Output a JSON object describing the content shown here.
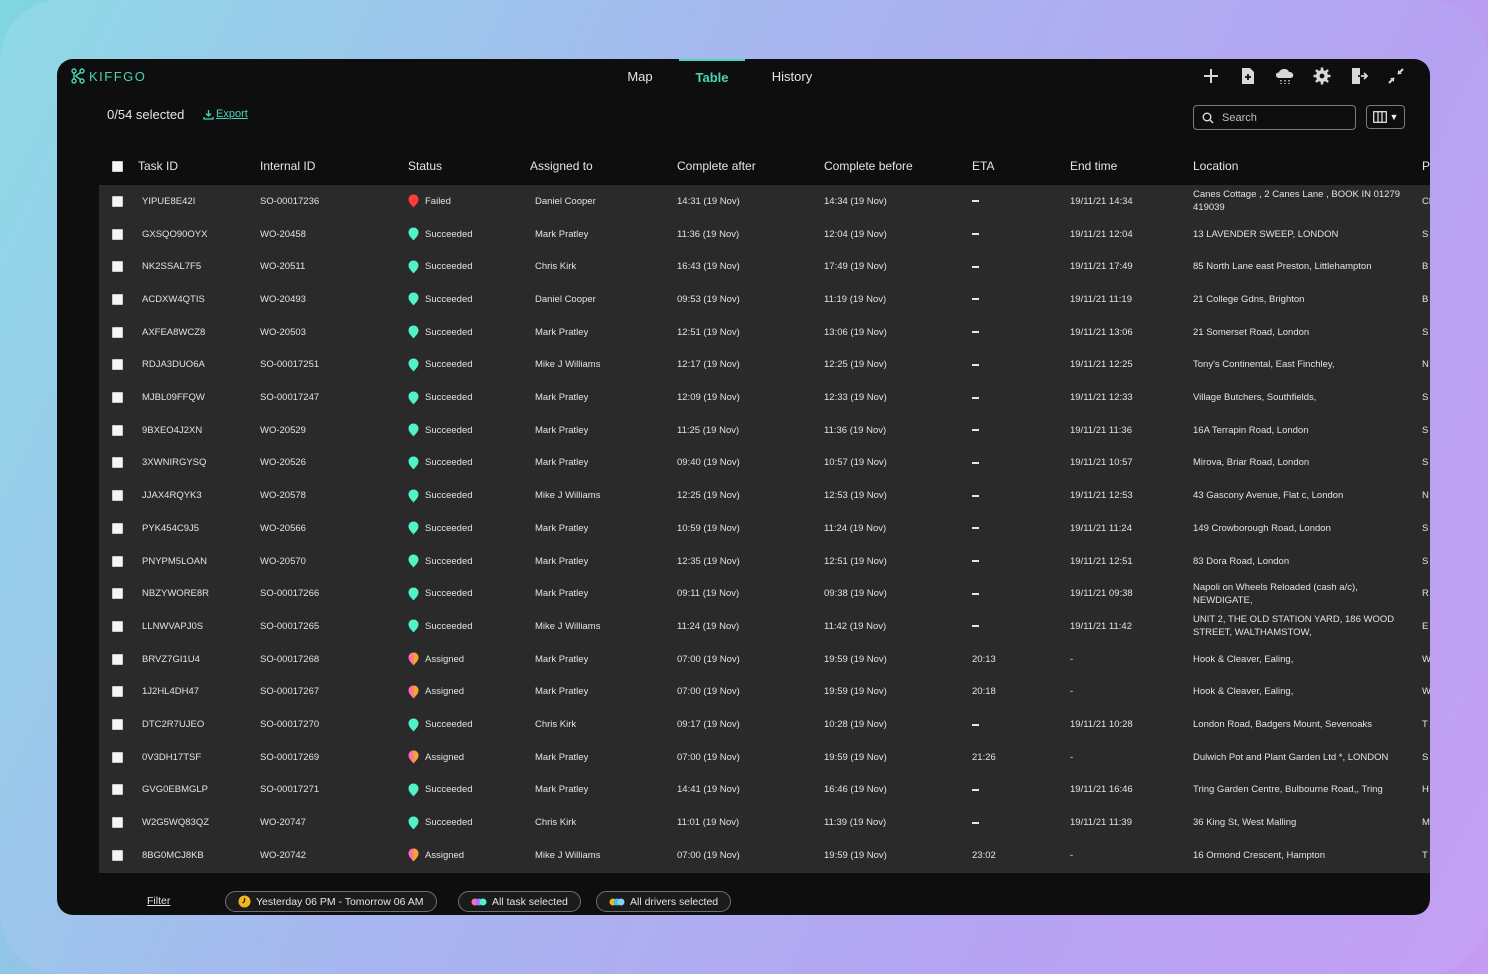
{
  "app": {
    "logo_text": "KIFFGO",
    "nav": {
      "tabs": [
        "Map",
        "Table",
        "History"
      ],
      "active": "Table"
    },
    "tools": [
      "plus-icon",
      "new-document-icon",
      "cloud-upload-icon",
      "gear-icon",
      "logout-icon",
      "collapse-icon"
    ]
  },
  "toolbar": {
    "selected": "0/54 selected",
    "export": "Export",
    "search_placeholder": "Search"
  },
  "table": {
    "columns": [
      "Task ID",
      "Internal ID",
      "Status",
      "Assigned to",
      "Complete after",
      "Complete before",
      "ETA",
      "End time",
      "Location",
      "P"
    ],
    "rows": [
      {
        "task_id": "YIPUE8E42I",
        "internal_id": "SO-00017236",
        "status": "Failed",
        "assigned": "Daniel Cooper",
        "after": "14:31 (19 Nov)",
        "before": "14:34 (19 Nov)",
        "eta": "",
        "end": "19/11/21 14:34",
        "location": "Canes Cottage , 2 Canes Lane , BOOK IN 01279 419039",
        "p": "Cl"
      },
      {
        "task_id": "GXSQO90OYX",
        "internal_id": "WO-20458",
        "status": "Succeeded",
        "assigned": "Mark Pratley",
        "after": "11:36 (19 Nov)",
        "before": "12:04 (19 Nov)",
        "eta": "",
        "end": "19/11/21 12:04",
        "location": "13 LAVENDER SWEEP, LONDON",
        "p": "S"
      },
      {
        "task_id": "NK2SSAL7F5",
        "internal_id": "WO-20511",
        "status": "Succeeded",
        "assigned": "Chris Kirk",
        "after": "16:43 (19 Nov)",
        "before": "17:49 (19 Nov)",
        "eta": "",
        "end": "19/11/21 17:49",
        "location": "85 North Lane east Preston, Littlehampton",
        "p": "B"
      },
      {
        "task_id": "ACDXW4QTIS",
        "internal_id": "WO-20493",
        "status": "Succeeded",
        "assigned": "Daniel Cooper",
        "after": "09:53 (19 Nov)",
        "before": "11:19 (19 Nov)",
        "eta": "",
        "end": "19/11/21 11:19",
        "location": "21 College Gdns, Brighton",
        "p": "B"
      },
      {
        "task_id": "AXFEA8WCZ8",
        "internal_id": "WO-20503",
        "status": "Succeeded",
        "assigned": "Mark Pratley",
        "after": "12:51 (19 Nov)",
        "before": "13:06 (19 Nov)",
        "eta": "",
        "end": "19/11/21 13:06",
        "location": "21 Somerset Road, London",
        "p": "S"
      },
      {
        "task_id": "RDJA3DUO6A",
        "internal_id": "SO-00017251",
        "status": "Succeeded",
        "assigned": "Mike J Williams",
        "after": "12:17 (19 Nov)",
        "before": "12:25 (19 Nov)",
        "eta": "",
        "end": "19/11/21 12:25",
        "location": "Tony's Continental, East Finchley,",
        "p": "N"
      },
      {
        "task_id": "MJBL09FFQW",
        "internal_id": "SO-00017247",
        "status": "Succeeded",
        "assigned": "Mark Pratley",
        "after": "12:09 (19 Nov)",
        "before": "12:33 (19 Nov)",
        "eta": "",
        "end": "19/11/21 12:33",
        "location": "Village Butchers, Southfields,",
        "p": "S"
      },
      {
        "task_id": "9BXEO4J2XN",
        "internal_id": "WO-20529",
        "status": "Succeeded",
        "assigned": "Mark Pratley",
        "after": "11:25 (19 Nov)",
        "before": "11:36 (19 Nov)",
        "eta": "",
        "end": "19/11/21 11:36",
        "location": "16A Terrapin Road, London",
        "p": "S"
      },
      {
        "task_id": "3XWNIRGYSQ",
        "internal_id": "WO-20526",
        "status": "Succeeded",
        "assigned": "Mark Pratley",
        "after": "09:40 (19 Nov)",
        "before": "10:57 (19 Nov)",
        "eta": "",
        "end": "19/11/21 10:57",
        "location": "Mirova, Briar Road, London",
        "p": "S"
      },
      {
        "task_id": "JJAX4RQYK3",
        "internal_id": "WO-20578",
        "status": "Succeeded",
        "assigned": "Mike J Williams",
        "after": "12:25 (19 Nov)",
        "before": "12:53 (19 Nov)",
        "eta": "",
        "end": "19/11/21 12:53",
        "location": "43 Gascony Avenue, Flat c, London",
        "p": "N"
      },
      {
        "task_id": "PYK454C9J5",
        "internal_id": "WO-20566",
        "status": "Succeeded",
        "assigned": "Mark Pratley",
        "after": "10:59 (19 Nov)",
        "before": "11:24 (19 Nov)",
        "eta": "",
        "end": "19/11/21 11:24",
        "location": "149 Crowborough Road, London",
        "p": "S"
      },
      {
        "task_id": "PNYPM5LOAN",
        "internal_id": "WO-20570",
        "status": "Succeeded",
        "assigned": "Mark Pratley",
        "after": "12:35 (19 Nov)",
        "before": "12:51 (19 Nov)",
        "eta": "",
        "end": "19/11/21 12:51",
        "location": "83 Dora Road, London",
        "p": "S"
      },
      {
        "task_id": "NBZYWORE8R",
        "internal_id": "SO-00017266",
        "status": "Succeeded",
        "assigned": "Mark Pratley",
        "after": "09:11 (19 Nov)",
        "before": "09:38 (19 Nov)",
        "eta": "",
        "end": "19/11/21 09:38",
        "location": "Napoli on Wheels Reloaded (cash a/c), NEWDIGATE,",
        "p": "R"
      },
      {
        "task_id": "LLNWVAPJ0S",
        "internal_id": "SO-00017265",
        "status": "Succeeded",
        "assigned": "Mike J Williams",
        "after": "11:24 (19 Nov)",
        "before": "11:42 (19 Nov)",
        "eta": "",
        "end": "19/11/21 11:42",
        "location": "UNIT 2, THE OLD STATION YARD, 186 WOOD STREET, WALTHAMSTOW,",
        "p": "E"
      },
      {
        "task_id": "BRVZ7GI1U4",
        "internal_id": "SO-00017268",
        "status": "Assigned",
        "assigned": "Mark Pratley",
        "after": "07:00 (19 Nov)",
        "before": "19:59 (19 Nov)",
        "eta": "20:13",
        "end": "-",
        "location": "Hook & Cleaver, Ealing,",
        "p": "W"
      },
      {
        "task_id": "1J2HL4DH47",
        "internal_id": "SO-00017267",
        "status": "Assigned",
        "assigned": "Mark Pratley",
        "after": "07:00 (19 Nov)",
        "before": "19:59 (19 Nov)",
        "eta": "20:18",
        "end": "-",
        "location": "Hook & Cleaver, Ealing,",
        "p": "W"
      },
      {
        "task_id": "DTC2R7UJEO",
        "internal_id": "SO-00017270",
        "status": "Succeeded",
        "assigned": "Chris Kirk",
        "after": "09:17 (19 Nov)",
        "before": "10:28 (19 Nov)",
        "eta": "",
        "end": "19/11/21 10:28",
        "location": "London Road, Badgers Mount, Sevenoaks",
        "p": "T"
      },
      {
        "task_id": "0V3DH17TSF",
        "internal_id": "SO-00017269",
        "status": "Assigned",
        "assigned": "Mark Pratley",
        "after": "07:00 (19 Nov)",
        "before": "19:59 (19 Nov)",
        "eta": "21:26",
        "end": "-",
        "location": "Dulwich Pot and Plant Garden Ltd *, LONDON",
        "p": "S"
      },
      {
        "task_id": "GVG0EBMGLP",
        "internal_id": "SO-00017271",
        "status": "Succeeded",
        "assigned": "Mark Pratley",
        "after": "14:41 (19 Nov)",
        "before": "16:46 (19 Nov)",
        "eta": "",
        "end": "19/11/21 16:46",
        "location": "Tring Garden Centre, Bulbourne Road,, Tring",
        "p": "H"
      },
      {
        "task_id": "W2G5WQ83QZ",
        "internal_id": "WO-20747",
        "status": "Succeeded",
        "assigned": "Chris Kirk",
        "after": "11:01 (19 Nov)",
        "before": "11:39 (19 Nov)",
        "eta": "",
        "end": "19/11/21 11:39",
        "location": "36 King St, West Malling",
        "p": "M"
      },
      {
        "task_id": "8BG0MCJ8KB",
        "internal_id": "WO-20742",
        "status": "Assigned",
        "assigned": "Mike J Williams",
        "after": "07:00 (19 Nov)",
        "before": "19:59 (19 Nov)",
        "eta": "23:02",
        "end": "-",
        "location": "16 Ormond Crescent, Hampton",
        "p": "T"
      }
    ]
  },
  "status_colors": {
    "Failed": "#ff3b3b",
    "Succeeded": "#52f2c9",
    "Assigned": "#ff6fb0"
  },
  "footer": {
    "filter": "Filter",
    "chips": [
      {
        "label": "Yesterday 06 PM - Tomorrow 06 AM",
        "icon": "clock-icon"
      },
      {
        "label": "All task selected",
        "icon": "task-pins-icon"
      },
      {
        "label": "All drivers selected",
        "icon": "drivers-icon"
      }
    ]
  }
}
